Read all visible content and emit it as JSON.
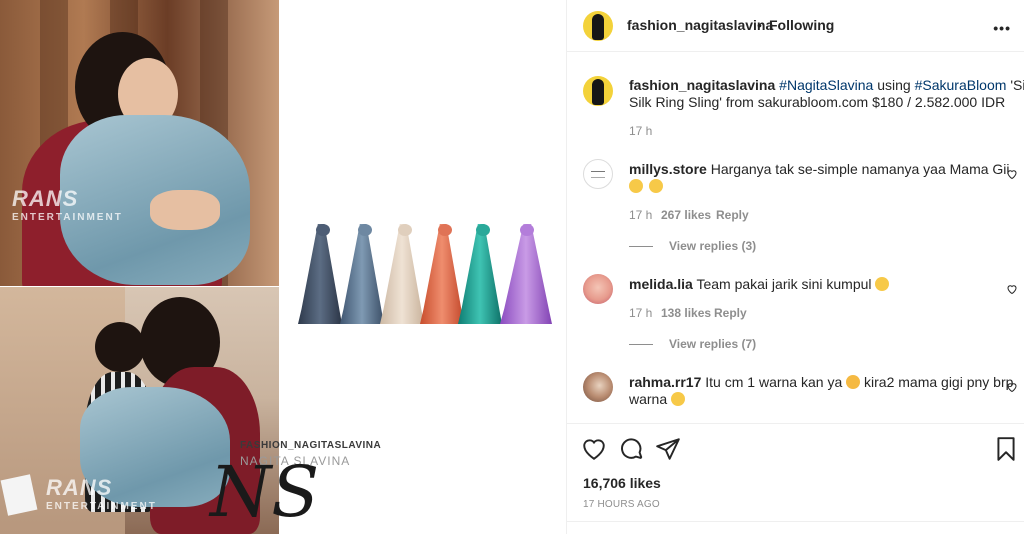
{
  "post": {
    "image_watermark_1": "RANS",
    "image_watermark_2": "ENTERTAINMENT",
    "image_watermark_3": "FASHION_NAGITASLAVINA",
    "image_watermark_4": "NAGITA SLAVINA",
    "image_signature": "NS"
  },
  "header": {
    "username": "fashion_nagitaslavina",
    "separator": "•",
    "follow_status": "Following",
    "more_icon": "more-options-icon"
  },
  "caption": {
    "username": "fashion_nagitaslavina",
    "hashtag_1": "#NagitaSlavina",
    "word_using": "using",
    "hashtag_2": "#SakuraBloom",
    "text_line1_end": "'Simple",
    "text_line2": "Silk Ring Sling' from sakurabloom.com $180 / 2.582.000 IDR",
    "time": "17 h"
  },
  "comments": [
    {
      "username": "millys.store",
      "text_line1": "Harganya tak se-simple namanya yaa Mama Gii",
      "time": "17 h",
      "likes": "267 likes",
      "reply": "Reply",
      "view_replies": "View replies (3)"
    },
    {
      "username": "melida.lia",
      "text_line1": "Team pakai jarik sini kumpul",
      "time": "17 h",
      "likes": "138 likes",
      "reply": "Reply",
      "view_replies": "View replies (7)"
    },
    {
      "username": "rahma.rr17",
      "text_line1_a": "Itu cm 1 warna kan ya",
      "text_line1_b": "kira2 mama gigi pny brp",
      "text_line2": "warna"
    }
  ],
  "actions": {
    "like_icon": "heart-icon",
    "comment_icon": "comment-icon",
    "share_icon": "share-icon",
    "save_icon": "bookmark-icon",
    "likes_count": "16,706 likes",
    "posted_ago": "17 HOURS AGO"
  },
  "colors": {
    "link": "#00376b",
    "secondary_text": "#8e8e8e",
    "border": "#efefef"
  }
}
